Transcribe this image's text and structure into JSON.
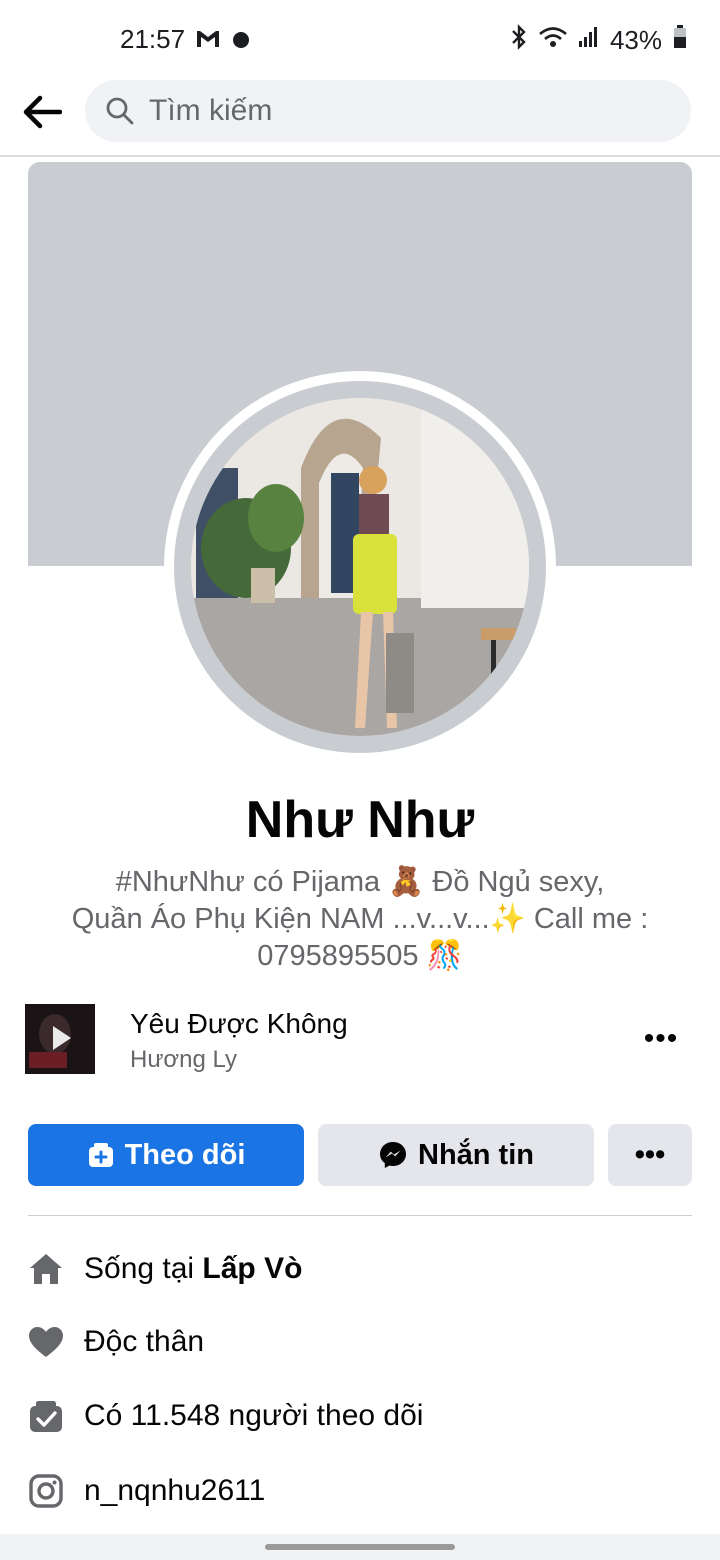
{
  "status_bar": {
    "time": "21:57",
    "battery": "43%",
    "icons": [
      "gmail-icon",
      "notification-dot-icon",
      "bluetooth-icon",
      "wifi-icon",
      "signal-icon",
      "battery-icon"
    ]
  },
  "header": {
    "search_placeholder": "Tìm kiếm"
  },
  "profile": {
    "name": "Như Như",
    "bio_line1": "#NhưNhư có Pijama 🧸 Đồ Ngủ sexy,",
    "bio_line2": "Quần Áo Phụ Kiện NAM ...v...v...✨ Call me :",
    "bio_line3": "0795895505 🎊"
  },
  "music": {
    "title": "Yêu Được Không",
    "artist": "Hương Ly",
    "more_label": "•••"
  },
  "actions": {
    "follow_label": "Theo dõi",
    "message_label": "Nhắn tin",
    "more_label": "•••"
  },
  "info": {
    "lives_prefix": "Sống tại ",
    "lives_place": "Lấp Vò",
    "relationship": "Độc thân",
    "followers": "Có 11.548 người theo dõi",
    "instagram": "n_nqnhu2611"
  },
  "colors": {
    "accent": "#1b74e4",
    "secondary_button": "#e4e6eb",
    "muted_text": "#65676b",
    "cover": "#c9ccd1"
  }
}
